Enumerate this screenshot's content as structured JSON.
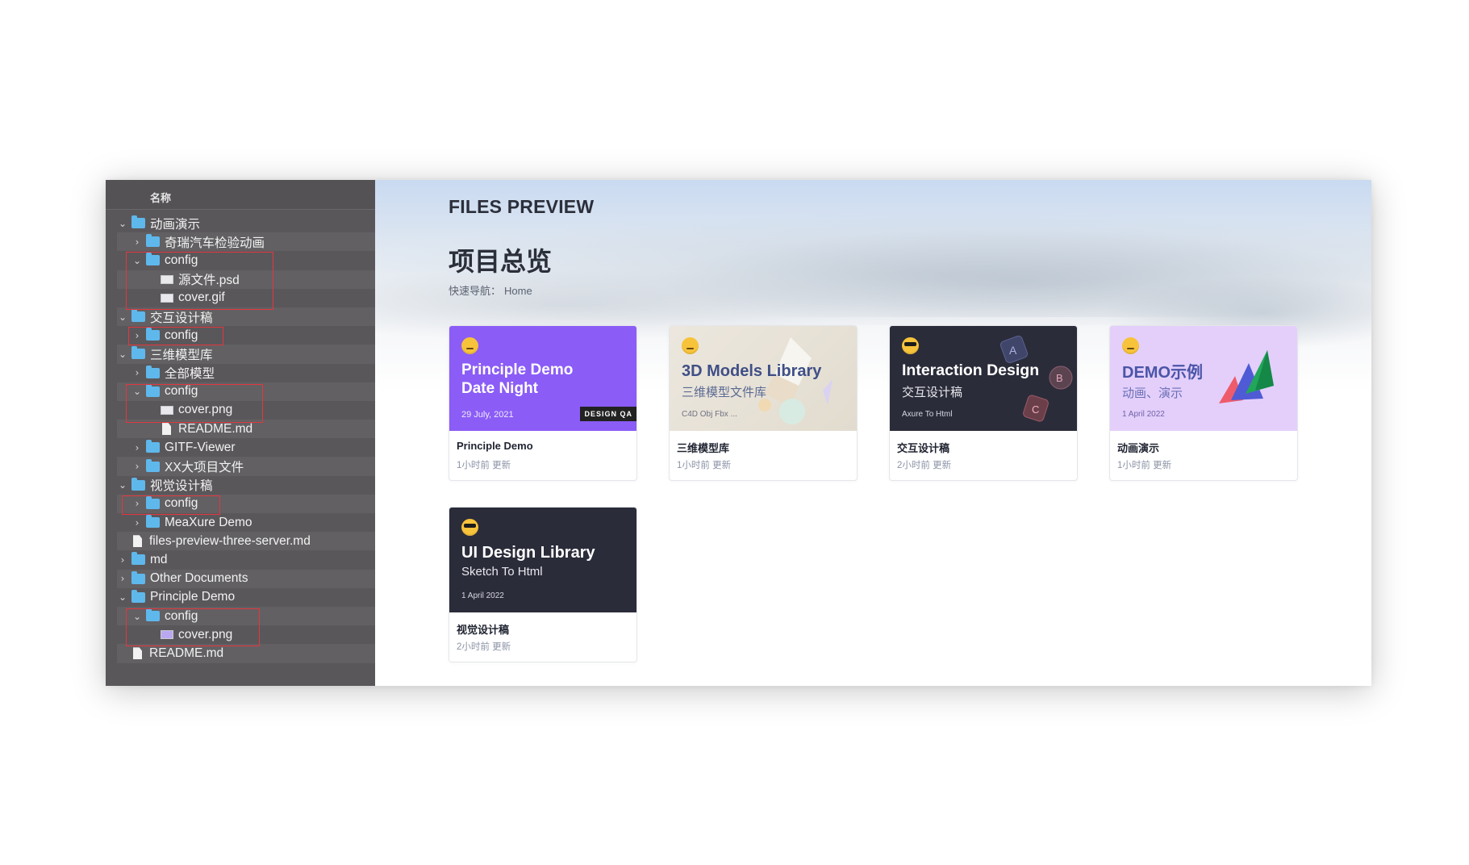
{
  "sidebar": {
    "header": "名称",
    "items": [
      {
        "label": "动画演示",
        "type": "folder",
        "depth": 0,
        "chev": "open"
      },
      {
        "label": "奇瑞汽车检验动画",
        "type": "folder",
        "depth": 1,
        "chev": "closed"
      },
      {
        "label": "config",
        "type": "folder",
        "depth": 1,
        "chev": "open"
      },
      {
        "label": "源文件.psd",
        "type": "image",
        "depth": 2,
        "chev": "none"
      },
      {
        "label": "cover.gif",
        "type": "image",
        "depth": 2,
        "chev": "none"
      },
      {
        "label": "交互设计稿",
        "type": "folder",
        "depth": 0,
        "chev": "open"
      },
      {
        "label": "config",
        "type": "folder",
        "depth": 1,
        "chev": "closed"
      },
      {
        "label": "三维模型库",
        "type": "folder",
        "depth": 0,
        "chev": "open"
      },
      {
        "label": "全部模型",
        "type": "folder",
        "depth": 1,
        "chev": "closed"
      },
      {
        "label": "config",
        "type": "folder",
        "depth": 1,
        "chev": "open"
      },
      {
        "label": "cover.png",
        "type": "image",
        "depth": 2,
        "chev": "none"
      },
      {
        "label": "README.md",
        "type": "file",
        "depth": 2,
        "chev": "none"
      },
      {
        "label": "GITF-Viewer",
        "type": "folder",
        "depth": 1,
        "chev": "closed"
      },
      {
        "label": "XX大项目文件",
        "type": "folder",
        "depth": 1,
        "chev": "closed"
      },
      {
        "label": "视觉设计稿",
        "type": "folder",
        "depth": 0,
        "chev": "open"
      },
      {
        "label": "config",
        "type": "folder",
        "depth": 1,
        "chev": "closed"
      },
      {
        "label": "MeaXure Demo",
        "type": "folder",
        "depth": 1,
        "chev": "closed"
      },
      {
        "label": "files-preview-three-server.md",
        "type": "file",
        "depth": 0,
        "chev": "none"
      },
      {
        "label": "md",
        "type": "folder",
        "depth": 0,
        "chev": "closed"
      },
      {
        "label": "Other Documents",
        "type": "folder",
        "depth": 0,
        "chev": "closed"
      },
      {
        "label": "Principle Demo",
        "type": "folder",
        "depth": 0,
        "chev": "open"
      },
      {
        "label": "config",
        "type": "folder",
        "depth": 1,
        "chev": "open"
      },
      {
        "label": "cover.png",
        "type": "image-purple",
        "depth": 2,
        "chev": "none"
      },
      {
        "label": "README.md",
        "type": "file",
        "depth": 0,
        "chev": "none"
      }
    ]
  },
  "header": {
    "app_title": "FILES PREVIEW",
    "page_title": "项目总览",
    "breadcrumb_label": "快速导航：",
    "breadcrumb_home": "Home"
  },
  "colors": {
    "accent_purple": "#8b5cf6",
    "dark_cover": "#2b2c3a",
    "lilac_cover": "#e4cffb",
    "beige_cover": "#ebe6dc",
    "highlight_red": "#e3373d",
    "folder_blue": "#5fb8ec"
  },
  "cards": [
    {
      "cover_title_1": "Principle Demo",
      "cover_title_2": "Date Night",
      "cover_date": "29 July, 2021",
      "cover_badge": "DESIGN QA",
      "name": "Principle Demo",
      "time": "1小时前 更新",
      "emoji": "thinking-face-icon"
    },
    {
      "cover_title": "3D Models Library",
      "cover_sub": "三维模型文件库",
      "cover_date": "C4D Obj Fbx ...",
      "name": "三维模型库",
      "time": "1小时前 更新",
      "emoji": "winking-face-icon"
    },
    {
      "cover_title": "Interaction Design",
      "cover_sub": "交互设计稿",
      "cover_date": "Axure To Html",
      "marks": [
        "A",
        "B",
        "C"
      ],
      "name": "交互设计稿",
      "time": "2小时前 更新",
      "emoji": "sunglasses-face-icon"
    },
    {
      "cover_title": "DEMO示例",
      "cover_sub": "动画、演示",
      "cover_date": "1 April 2022",
      "name": "动画演示",
      "time": "1小时前 更新",
      "emoji": "partying-face-icon"
    },
    {
      "cover_title": "UI Design Library",
      "cover_sub": "Sketch To Html",
      "cover_date": "1 April 2022",
      "name": "视觉设计稿",
      "time": "2小时前 更新",
      "emoji": "sunglasses-face-icon"
    }
  ]
}
